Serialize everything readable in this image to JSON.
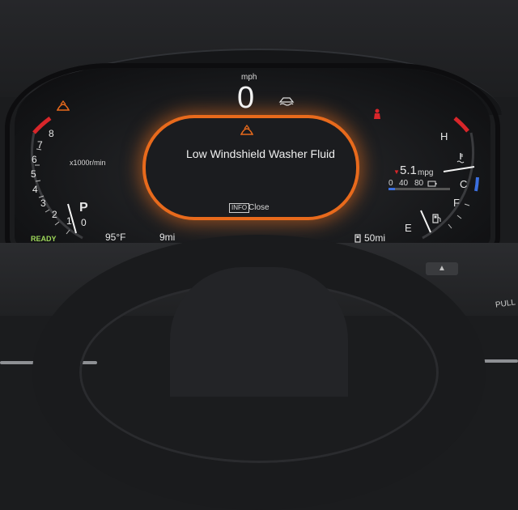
{
  "cluster": {
    "speed_unit": "mph",
    "speed_value": "0",
    "message": "Low Windshield Washer Fluid",
    "info_button_label": "INFO",
    "info_close_label": "Close",
    "rpm_unit": "x1000r/min",
    "tach_ticks": [
      "1",
      "2",
      "3",
      "4",
      "5",
      "6",
      "7",
      "8"
    ],
    "gear": "P",
    "tach_zero": "0",
    "ready_label": "READY",
    "outside_temp": "95°F",
    "trip_range": "9mi",
    "fuel_range": "50mi",
    "mpg_value": "5.1",
    "mpg_unit": "mpg",
    "mpg_scale": [
      "0",
      "40",
      "80"
    ],
    "temp_high": "H",
    "temp_cold": "C",
    "fuel_full": "F",
    "fuel_empty": "E",
    "rpm_needle_value": 0,
    "temp_level": 0.45,
    "fuel_level": 0.12
  },
  "colors": {
    "accent_orange": "#e86a1c",
    "warning_red": "#d8262a",
    "ready_green": "#9ed85a",
    "cold_blue": "#3b6fe0"
  },
  "icons": {
    "washer_warning": "washer-fluid-icon",
    "seatbelt": "seatbelt-icon",
    "traction": "traction-control-icon",
    "coolant": "coolant-temp-icon",
    "fuel": "fuel-pump-icon"
  },
  "car": {
    "hazard_label": "▲",
    "pull_label": "PULL"
  }
}
